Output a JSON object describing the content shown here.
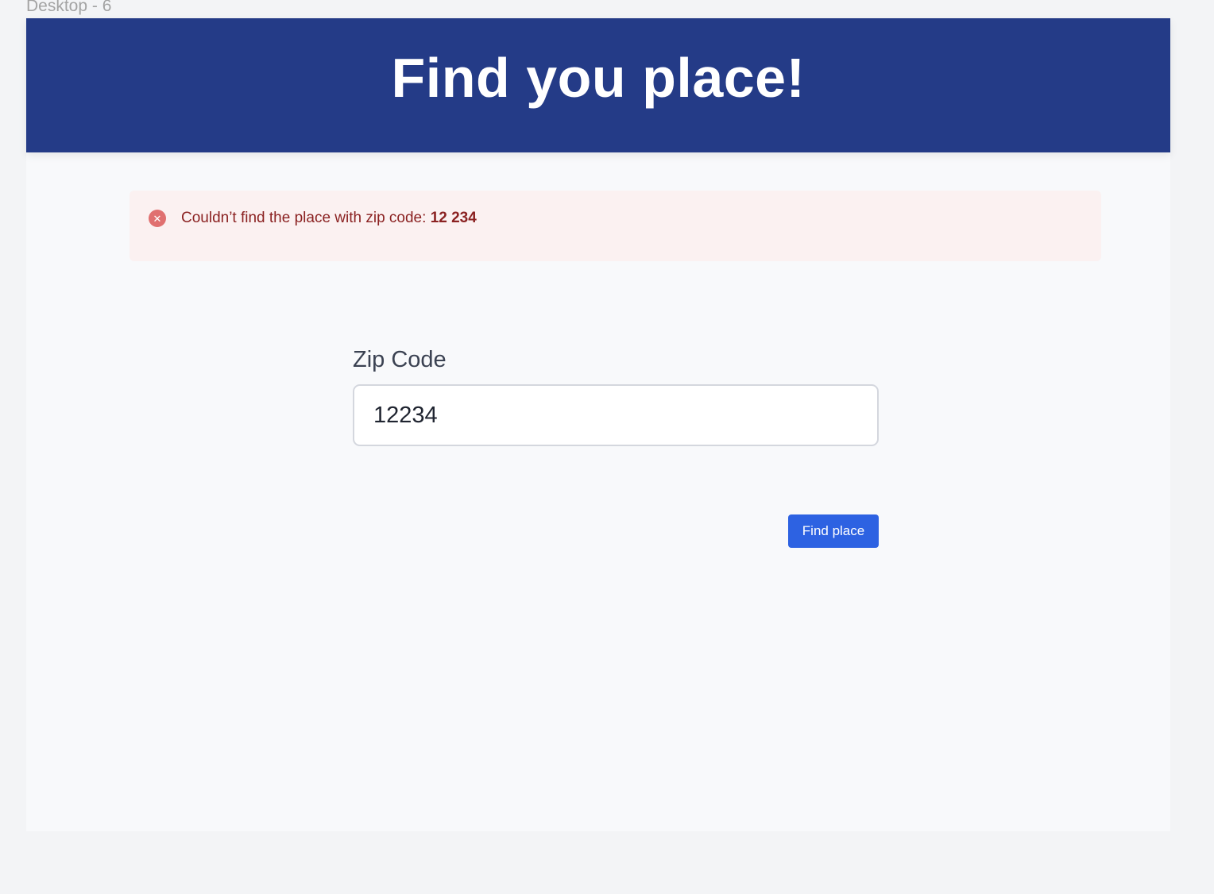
{
  "frame": {
    "label": "Desktop - 6"
  },
  "header": {
    "title": "Find you place!"
  },
  "alert": {
    "icon": "x-circle-icon",
    "message": "Couldn’t find the place with zip code: ",
    "zip": "12 234",
    "colors": {
      "background": "#fbf1f1",
      "text": "#8b2222",
      "icon": "#e07070"
    }
  },
  "form": {
    "zip_label": "Zip Code",
    "zip_value": "12234",
    "submit_label": "Find place"
  },
  "colors": {
    "header": "#243b87",
    "button": "#2d62e2"
  }
}
